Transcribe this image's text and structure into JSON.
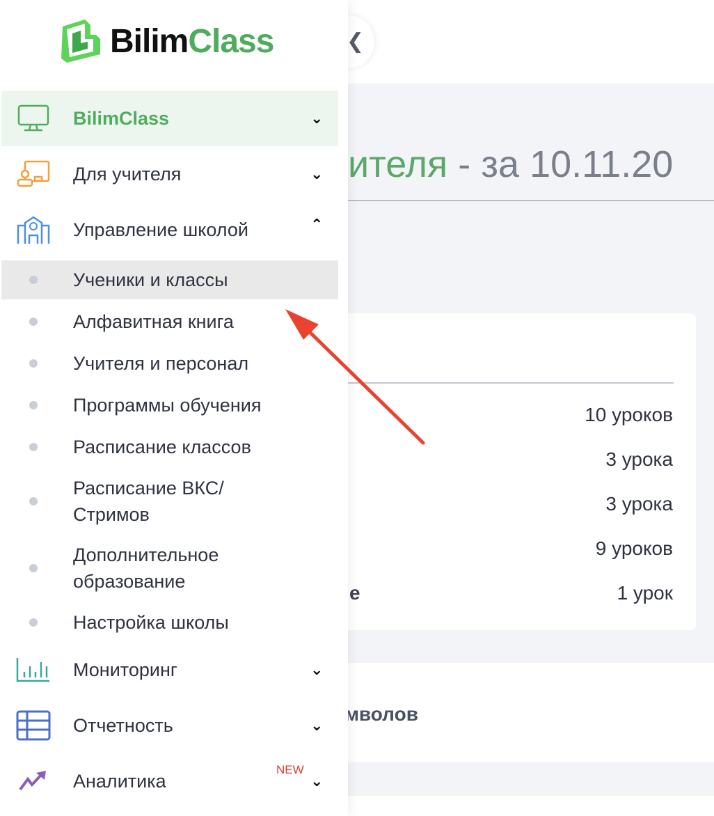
{
  "logo": {
    "part1": "Bilim",
    "part2": "Class"
  },
  "collapse_icon": "chevron-left",
  "main": {
    "title_green": "ителя",
    "title_rest": " - за 10.11.20",
    "rows": [
      {
        "label": "",
        "value": "10 уроков"
      },
      {
        "label": "",
        "value": "3 урока"
      },
      {
        "label": "",
        "value": "3 урока"
      },
      {
        "label": "",
        "value": "9 уроков"
      },
      {
        "label": "е",
        "value": "1 урок"
      }
    ],
    "panel2_title": "имволов"
  },
  "sidebar": {
    "items": [
      {
        "label": "BilimClass",
        "icon": "monitor-icon",
        "color": "#4fac5e",
        "expanded": false
      },
      {
        "label": "Для учителя",
        "icon": "teacher-board-icon",
        "color": "#f0a03c",
        "expanded": false
      },
      {
        "label": "Управление школой",
        "icon": "school-building-icon",
        "color": "#4a90e2",
        "expanded": true
      }
    ],
    "subitems": [
      "Ученики и классы",
      "Алфавитная книга",
      "Учителя и персонал",
      "Программы обучения",
      "Расписание классов",
      "Расписание ВКС/ Стримов",
      "Дополнительное образование",
      "Настройка школы"
    ],
    "bottom_items": [
      {
        "label": "Мониторинг",
        "icon": "bar-chart-icon",
        "color": "#3aa6a0"
      },
      {
        "label": "Отчетность",
        "icon": "table-icon",
        "color": "#4a6fc4"
      },
      {
        "label": "Аналитика",
        "icon": "trend-up-icon",
        "color": "#8a5cc0",
        "badge": "NEW"
      }
    ]
  },
  "annotation_color": "#e8432f"
}
